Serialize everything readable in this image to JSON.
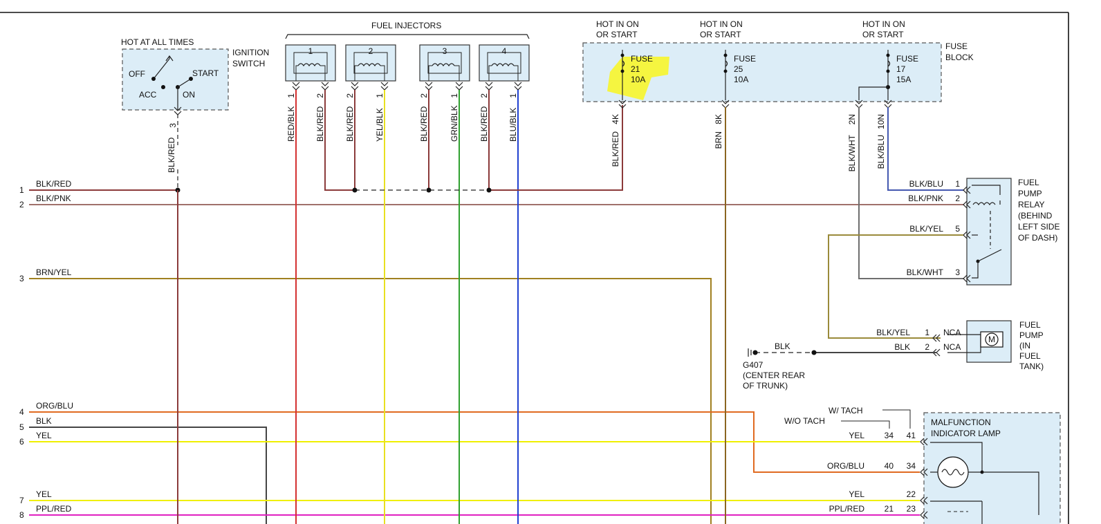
{
  "diagram": {
    "colors": {
      "blk_red": "#8b3a3a",
      "blk_pnk": "#a0716b",
      "brn_yel": "#a08020",
      "red_blk": "#d43030",
      "yel_blk": "#e8e020",
      "grn_blk": "#2fa02f",
      "blu_blk": "#2040d0",
      "brn": "#8b6520",
      "blk_wht": "#6e6e6e",
      "blk_blu": "#4458b0",
      "blk_yel": "#9a8a3a",
      "blk": "#444444",
      "org_blu": "#e06a20",
      "yel": "#f0f000",
      "ppl_red": "#e020c0",
      "highlight": "#f5f540",
      "selection": "#2d7fe0"
    },
    "injectors": {
      "title_prefix": "FUEL ",
      "title_selected": "INJECTORS",
      "items": [
        {
          "number": "1",
          "pin_a": "1",
          "pin_b": "2",
          "wire_a": "RED/BLK",
          "wire_b": "BLK/RED"
        },
        {
          "number": "2",
          "pin_a": "2",
          "pin_b": "1",
          "wire_a": "BLK/RED",
          "wire_b": "YEL/BLK"
        },
        {
          "number": "3",
          "pin_a": "2",
          "pin_b": "1",
          "wire_a": "BLK/RED",
          "wire_b": "GRN/BLK"
        },
        {
          "number": "4",
          "pin_a": "2",
          "pin_b": "1",
          "wire_a": "BLK/RED",
          "wire_b": "BLU/BLK"
        }
      ]
    },
    "ignition": {
      "hot_label": "HOT AT ALL TIMES",
      "title_line1": "IGNITION",
      "title_line2": "SWITCH",
      "off": "OFF",
      "start": "START",
      "acc": "ACC",
      "on": "ON",
      "pin": "3",
      "wire": "BLK/RED"
    },
    "fuse_block": {
      "title_line1": "FUSE",
      "title_line2": "BLOCK",
      "fuses": [
        {
          "hot_line1": "HOT IN ON",
          "hot_line2": "OR START",
          "label": "FUSE",
          "number": "21",
          "rating": "10A",
          "pin": "4K",
          "wire": "BLK/RED"
        },
        {
          "hot_line1": "HOT IN ON",
          "hot_line2": "OR START",
          "label": "FUSE",
          "number": "25",
          "rating": "10A",
          "pin": "8K",
          "wire": "BRN"
        },
        {
          "hot_line1": "HOT IN ON",
          "hot_line2": "OR START",
          "label": "FUSE",
          "number": "17",
          "rating": "15A",
          "pin_a": "2N",
          "pin_b": "10N",
          "wire_a": "BLK/WHT",
          "wire_b": "BLK/BLU"
        }
      ]
    },
    "left_wires": [
      {
        "number": "1",
        "label": "BLK/RED"
      },
      {
        "number": "2",
        "label": "BLK/PNK"
      },
      {
        "number": "3",
        "label": "BRN/YEL"
      },
      {
        "number": "4",
        "label": "ORG/BLU"
      },
      {
        "number": "5",
        "label": "BLK"
      },
      {
        "number": "6",
        "label": "YEL"
      },
      {
        "number": "7",
        "label": "YEL"
      },
      {
        "number": "8",
        "label": "PPL/RED"
      }
    ],
    "relay": {
      "title_lines": [
        "FUEL",
        "PUMP",
        "RELAY",
        "(BEHIND",
        "LEFT SIDE",
        "OF DASH)"
      ],
      "pins": [
        {
          "wire": "BLK/BLU",
          "pin": "1"
        },
        {
          "wire": "BLK/PNK",
          "pin": "2"
        },
        {
          "wire": "BLK/YEL",
          "pin": "5"
        },
        {
          "wire": "BLK/WHT",
          "pin": "3"
        }
      ]
    },
    "pump": {
      "title_lines": [
        "FUEL",
        "PUMP",
        "(IN",
        "FUEL",
        "TANK)"
      ],
      "motor": "M",
      "pins": [
        {
          "wire": "BLK/YEL",
          "pin": "1",
          "nca": "NCA"
        },
        {
          "wire": "BLK",
          "pin": "2",
          "nca": "NCA"
        }
      ],
      "ground_wire": "BLK",
      "ground_lines": [
        "G407",
        "(CENTER REAR",
        "OF TRUNK)"
      ]
    },
    "mil": {
      "title_line1": "MALFUNCTION",
      "title_line2": "INDICATOR LAMP",
      "w_tach": "W/ TACH",
      "wo_tach": "W/O TACH",
      "rows": [
        {
          "wire": "YEL",
          "pin_wo": "34",
          "pin_w": "41"
        },
        {
          "wire": "ORG/BLU",
          "pin_wo": "40",
          "pin_w": "34"
        },
        {
          "wire": "YEL",
          "pin_wo": "",
          "pin_w": "22"
        },
        {
          "wire": "PPL/RED",
          "pin_wo": "21",
          "pin_w": "23"
        }
      ]
    }
  }
}
